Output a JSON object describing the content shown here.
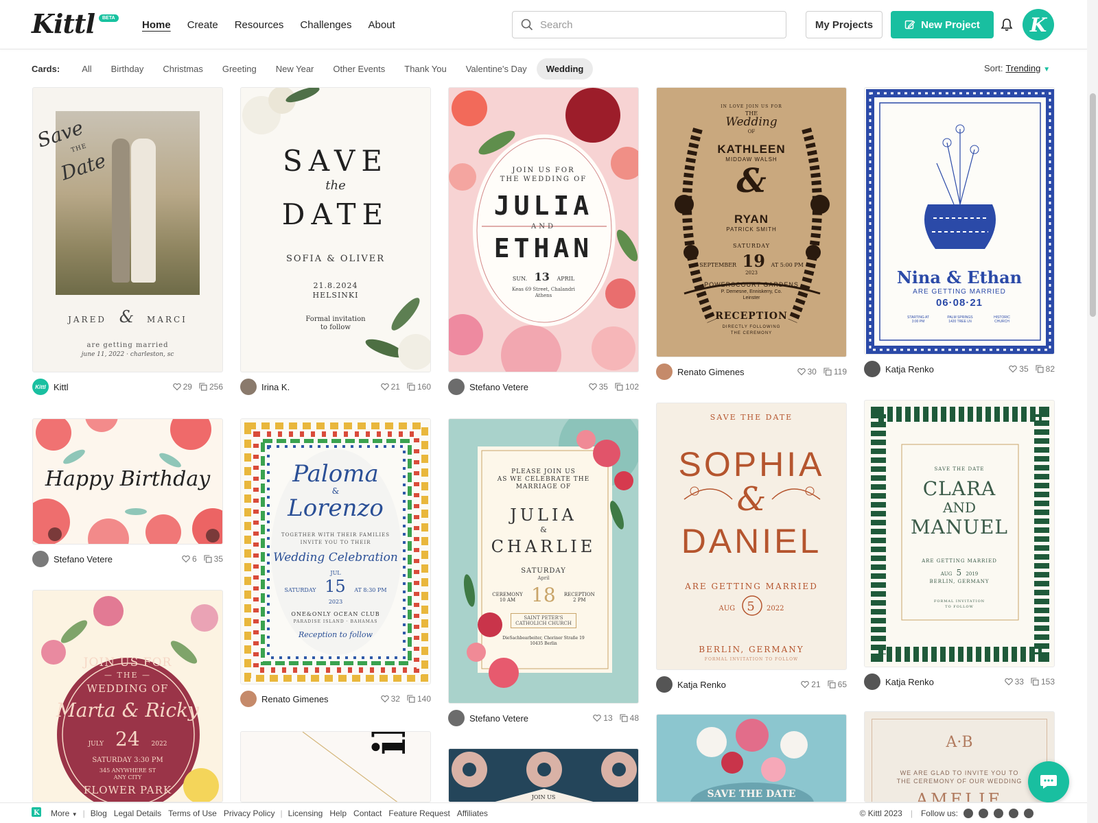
{
  "brand": {
    "logo": "Kittl",
    "badge": "BETA",
    "accent": "#19bfa0"
  },
  "nav": [
    {
      "label": "Home"
    },
    {
      "label": "Create"
    },
    {
      "label": "Resources"
    },
    {
      "label": "Challenges"
    },
    {
      "label": "About"
    }
  ],
  "search": {
    "placeholder": "Search",
    "icon": "search-icon"
  },
  "actions": {
    "my_projects": "My Projects",
    "new_project": "New Project"
  },
  "filters": {
    "label": "Cards:",
    "chips": [
      "All",
      "Birthday",
      "Christmas",
      "Greeting",
      "New Year",
      "Other Events",
      "Thank You",
      "Valentine's Day",
      "Wedding"
    ],
    "active": "Wedding"
  },
  "sort": {
    "label": "Sort:",
    "value": "Trending"
  },
  "cards": [
    {
      "author": "Kittl",
      "likes": "29",
      "copies": "256",
      "l1": "Save",
      "l2": "THE",
      "l3": "Date",
      "l4": "JARED",
      "l5": "MARCI",
      "l6": "are getting married",
      "l7": "june 11, 2022 · charleston, sc",
      "l8": "&"
    },
    {
      "author": "Irina K.",
      "likes": "21",
      "copies": "160",
      "l1": "SAVE",
      "l2": "the",
      "l3": "DATE",
      "l4": "SOFIA & OLIVER",
      "l5": "21.8.2024",
      "l6": "HELSINKI",
      "l7": "Formal invitation",
      "l8": "to follow"
    },
    {
      "author": "Stefano Vetere",
      "likes": "35",
      "copies": "102",
      "l1": "JOIN US FOR",
      "l2": "THE WEDDING OF",
      "l3": "JULIA",
      "l4": "AND",
      "l5": "ETHAN",
      "l6": "SUN.",
      "l7": "13",
      "l8": "APRIL",
      "l9": "Keas 69 Street, Chalandri",
      "l10": "Athens"
    },
    {
      "author": "Renato Gimenes",
      "likes": "30",
      "copies": "119",
      "l1": "IN LOVE JOIN US FOR",
      "l2": "THE",
      "l3": "Wedding",
      "l4": "OF",
      "l5": "KATHLEEN",
      "l6": "MIDDAW WALSH",
      "l7": "&",
      "l8": "RYAN",
      "l9": "PATRICK SMITH",
      "l10": "SATURDAY",
      "l11": "SEPTEMBER",
      "l12": "19",
      "l13": "AT 5:00 PM",
      "l14": "2023",
      "l15": "POWERSCOURT GARDENS",
      "l16": "P. Demesne, Enniskerry, Co.",
      "l17": "Leinster",
      "l18": "RECEPTION",
      "l19": "DIRECTLY FOLLOWING",
      "l20": "THE CEREMONY"
    },
    {
      "author": "Katja Renko",
      "likes": "35",
      "copies": "82",
      "l1": "Nina & Ethan",
      "l2": "ARE GETTING MARRIED",
      "l3": "06·08·21",
      "l4": "STARTING AT",
      "l5": "3:00 PM",
      "l6": "PALM SPRINGS",
      "l7": "1420 TREE LN",
      "l8": "HISTORIC",
      "l9": "CHURCH"
    },
    {
      "author": "Stefano Vetere",
      "likes": "6",
      "copies": "35",
      "l1": "Happy Birthday"
    },
    {
      "author": "Renato Gimenes",
      "likes": "32",
      "copies": "140",
      "l1": "Paloma",
      "l2": "&",
      "l3": "Lorenzo",
      "l4": "TOGETHER WITH THEIR FAMILIES",
      "l5": "INVITE YOU TO THEIR",
      "l6": "Wedding Celebration",
      "l7": "JUL",
      "l8": "SATURDAY",
      "l9": "15",
      "l10": "AT 8:30 PM",
      "l11": "2023",
      "l12": "ONE&ONLY OCEAN CLUB",
      "l13": "PARADISE ISLAND · BAHAMAS",
      "l14": "Reception to follow"
    },
    {
      "author": "Stefano Vetere",
      "likes": "13",
      "copies": "48",
      "l1": "PLEASE JOIN US",
      "l2": "AS WE CELEBRATE THE",
      "l3": "MARRIAGE OF",
      "l4": "JULIA",
      "l5": "&",
      "l6": "CHARLIE",
      "l7": "SATURDAY",
      "l8": "April",
      "l9": "CEREMONY",
      "l10": "10 AM",
      "l11": "18",
      "l12": "RECEPTION",
      "l13": "2 PM",
      "l14": "SAINT PETER'S",
      "l15": "CATHOLICH CHURCH",
      "l16": "DieSachbearbeiter, Choriner Straße 19",
      "l17": "10435 Berlin"
    },
    {
      "author": "Katja Renko",
      "likes": "21",
      "copies": "65",
      "l1": "SAVE THE DATE",
      "l2": "SOPHIA",
      "l3": "&",
      "l4": "DANIEL",
      "l5": "ARE GETTING MARRIED",
      "l6": "AUG",
      "l7": "5",
      "l8": "2022",
      "l9": "BERLIN, GERMANY",
      "l10": "FORMAL INVITATION TO FOLLOW"
    },
    {
      "author": "Katja Renko",
      "likes": "33",
      "copies": "153",
      "l1": "SAVE THE DATE",
      "l2": "CLARA",
      "l3": "AND",
      "l4": "MANUEL",
      "l5": "ARE GETTING MARRIED",
      "l6": "AUG",
      "l7": "5",
      "l8": "2019",
      "l9": "BERLIN, GERMANY",
      "l10": "FORMAL INVITATION",
      "l11": "TO FOLLOW"
    },
    {
      "l1": "JOIN US FOR",
      "l2": "— THE —",
      "l3": "WEDDING OF",
      "l4": "Marta & Ricky",
      "l5": "JULY",
      "l6": "24",
      "l7": "2022",
      "l8": "SATURDAY 3:30 PM",
      "l9": "345 ANYWHERE ST",
      "l10": "ANY CITY",
      "l11": "FLOWER PARK"
    },
    {
      "l1": "ike"
    },
    {
      "l1": "JOIN US"
    },
    {
      "l1": "SAVE THE DATE"
    },
    {
      "l1": "A·B",
      "l2": "WE ARE GLAD TO INVITE YOU TO",
      "l3": "THE CEREMONY OF OUR WEDDING",
      "l4": "AMELIE"
    }
  ],
  "footer": {
    "more": "More",
    "links": [
      "Blog",
      "Legal Details",
      "Terms of Use",
      "Privacy Policy"
    ],
    "links2": [
      "Licensing",
      "Help",
      "Contact",
      "Feature Request",
      "Affiliates"
    ],
    "copyright": "© Kittl 2023",
    "follow": "Follow us:",
    "social_icons": [
      "facebook-icon",
      "youtube-icon",
      "instagram-icon",
      "pinterest-icon",
      "twitter-icon"
    ]
  }
}
